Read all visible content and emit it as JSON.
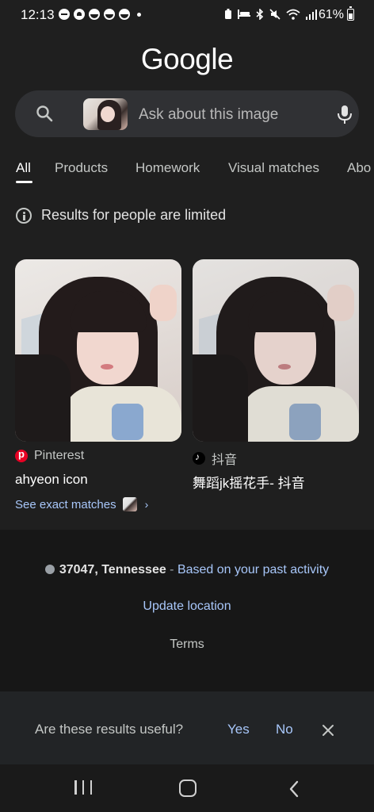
{
  "status_bar": {
    "time": "12:13",
    "battery_percent": "61%"
  },
  "logo": "Google",
  "search": {
    "placeholder": "Ask about this image"
  },
  "tabs": [
    {
      "label": "All",
      "active": true
    },
    {
      "label": "Products",
      "active": false
    },
    {
      "label": "Homework",
      "active": false
    },
    {
      "label": "Visual matches",
      "active": false
    },
    {
      "label": "Abo",
      "active": false
    }
  ],
  "notice": "Results for people are limited",
  "results": [
    {
      "source": "Pinterest",
      "title": "ahyeon icon",
      "source_icon": "pinterest-icon"
    },
    {
      "source": "抖音",
      "title": "舞蹈jk摇花手- 抖音",
      "source_icon": "tiktok-icon"
    }
  ],
  "exact_matches_link": "See exact matches",
  "location": {
    "zip": "37047, Tennessee",
    "separator": " - ",
    "basis": "Based on your past activity",
    "update_label": "Update location"
  },
  "terms": "Terms",
  "feedback": {
    "question": "Are these results useful?",
    "yes": "Yes",
    "no": "No"
  },
  "colors": {
    "background": "#1f1f1f",
    "link": "#a8c7fa",
    "pinterest": "#e60023"
  }
}
